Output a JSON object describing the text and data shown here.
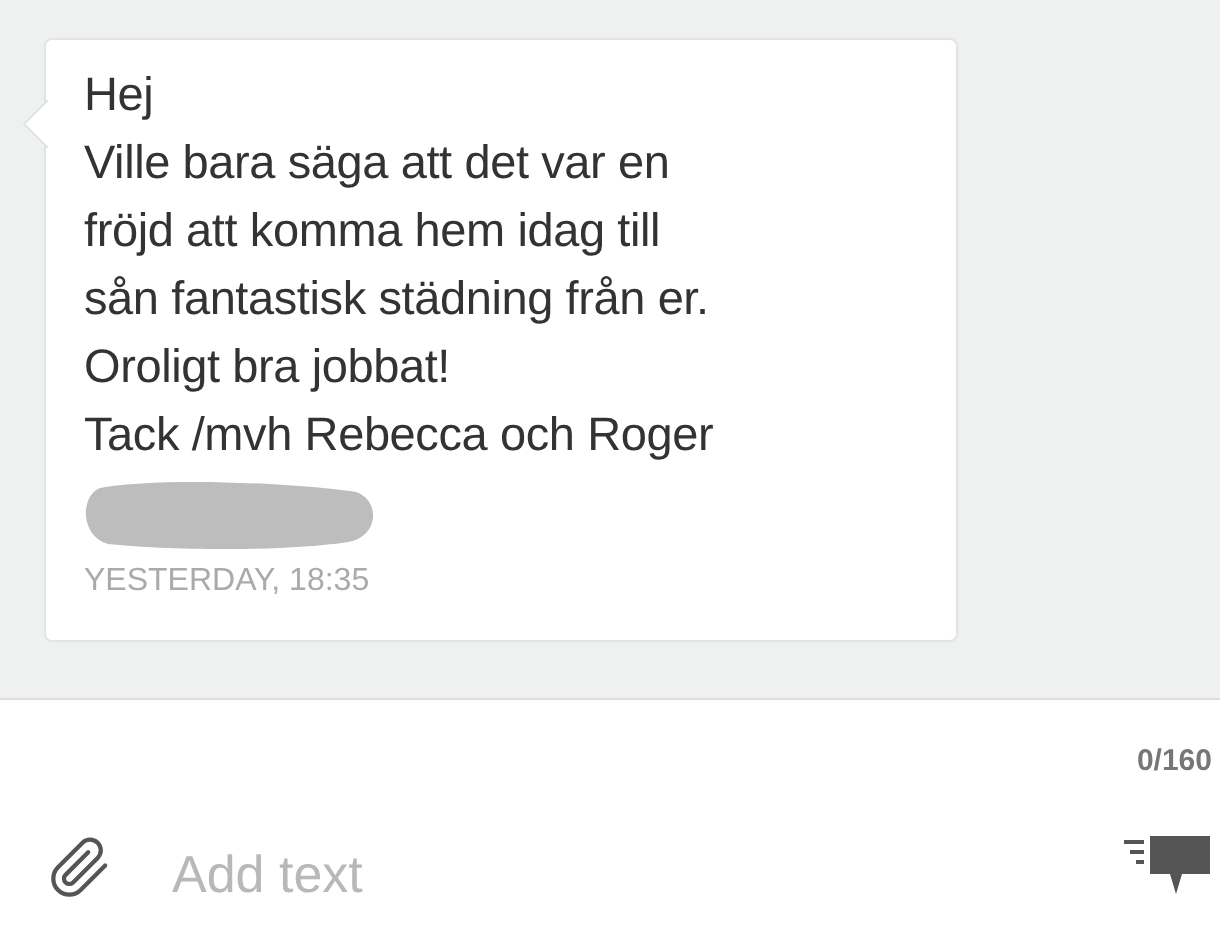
{
  "message": {
    "lines": [
      "Hej",
      "Ville bara säga att det var en",
      "fröjd att komma hem idag till",
      "sån fantastisk städning från er.",
      "Oroligt bra jobbat!",
      "Tack /mvh Rebecca och Roger"
    ],
    "timestamp": "YESTERDAY, 18:35"
  },
  "composer": {
    "counter": "0/160",
    "placeholder": "Add text"
  }
}
